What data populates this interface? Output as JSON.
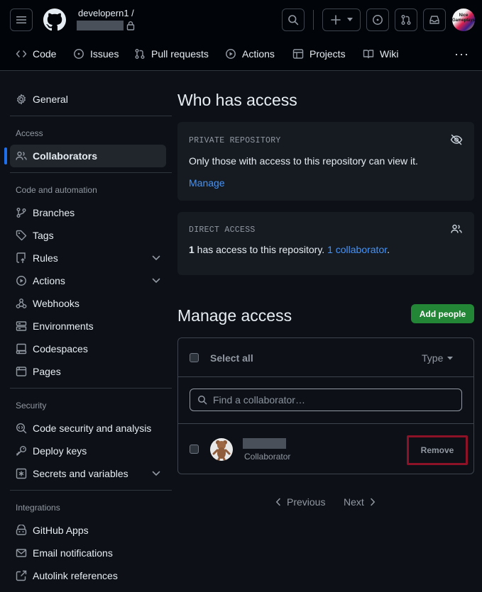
{
  "header": {
    "owner": "developern1 /",
    "avatar_text": "Nice Gameplays"
  },
  "nav": {
    "tabs": [
      "Code",
      "Issues",
      "Pull requests",
      "Actions",
      "Projects",
      "Wiki"
    ],
    "more": "···"
  },
  "sidebar": {
    "general": "General",
    "sections": [
      {
        "heading": "Access",
        "items": [
          "Collaborators"
        ]
      },
      {
        "heading": "Code and automation",
        "items": [
          "Branches",
          "Tags",
          "Rules",
          "Actions",
          "Webhooks",
          "Environments",
          "Codespaces",
          "Pages"
        ]
      },
      {
        "heading": "Security",
        "items": [
          "Code security and analysis",
          "Deploy keys",
          "Secrets and variables"
        ]
      },
      {
        "heading": "Integrations",
        "items": [
          "GitHub Apps",
          "Email notifications",
          "Autolink references"
        ]
      }
    ]
  },
  "who_has_access": {
    "title": "Who has access",
    "private_label": "PRIVATE REPOSITORY",
    "private_text": "Only those with access to this repository can view it.",
    "manage_link": "Manage",
    "direct_label": "DIRECT ACCESS",
    "direct_count": "1",
    "direct_text": " has access to this repository. ",
    "direct_link": "1 collaborator",
    "direct_end": "."
  },
  "manage_access": {
    "title": "Manage access",
    "add_button": "Add people",
    "select_all": "Select all",
    "type_filter": "Type",
    "search_placeholder": "Find a collaborator…",
    "collaborator_role": "Collaborator",
    "remove_button": "Remove"
  },
  "pagination": {
    "previous": "Previous",
    "next": "Next"
  },
  "colors": {
    "accent": "#1f6feb",
    "link": "#4493f8",
    "primary_button": "#238636",
    "remove_highlight": "#8e1227"
  }
}
